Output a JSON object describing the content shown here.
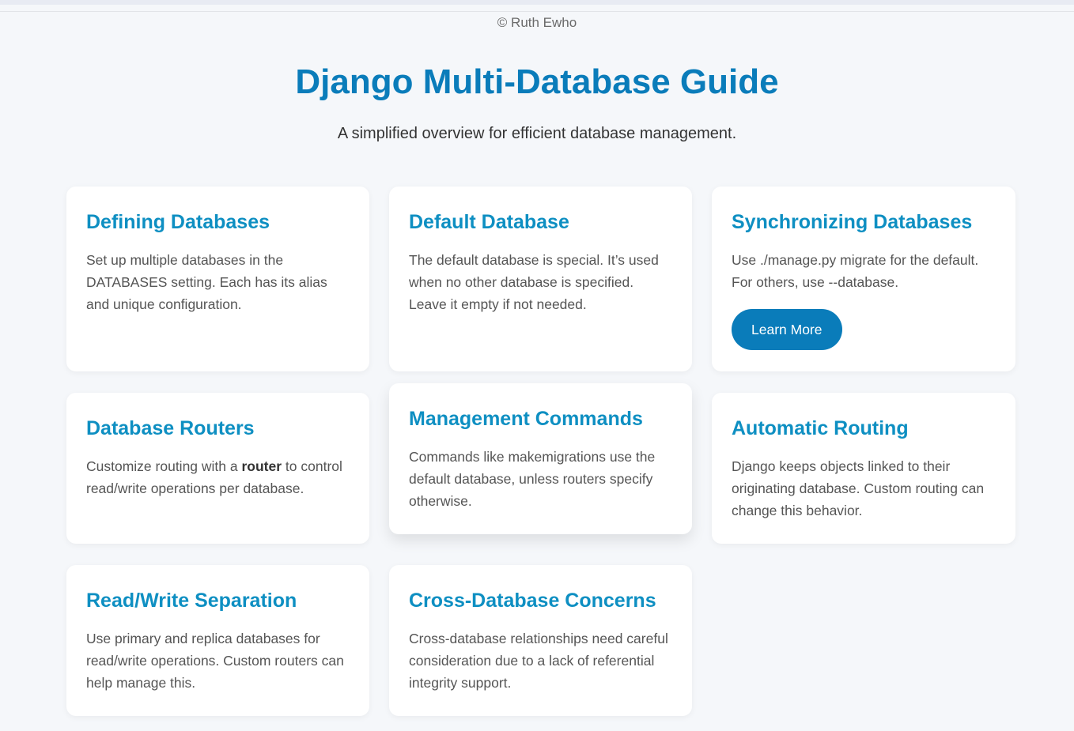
{
  "header": {
    "copyright": "© Ruth Ewho",
    "title": "Django Multi-Database Guide",
    "subtitle": "A simplified overview for efficient database management."
  },
  "cards": [
    {
      "title": "Defining Databases",
      "body": "Set up multiple databases in the DATABASES setting. Each has its alias and unique configuration."
    },
    {
      "title": "Default Database",
      "body": "The default database is special. It’s used when no other database is specified. Leave it empty if not needed."
    },
    {
      "title": "Synchronizing Databases",
      "body": "Use ./manage.py migrate for the default. For others, use --database.",
      "button_label": "Learn More"
    },
    {
      "title": "Database Routers",
      "body_before": "Customize routing with a ",
      "body_strong": "router",
      "body_after": " to control read/write operations per database."
    },
    {
      "title": "Management Commands",
      "body": "Commands like makemigrations use the default database, unless routers specify otherwise."
    },
    {
      "title": "Automatic Routing",
      "body": "Django keeps objects linked to their originating database. Custom routing can change this behavior."
    },
    {
      "title": "Read/Write Separation",
      "body": "Use primary and replica databases for read/write operations. Custom routers can help manage this."
    },
    {
      "title": "Cross-Database Concerns",
      "body": "Cross-database relationships need careful consideration due to a lack of referential integrity support."
    }
  ],
  "colors": {
    "title": "#0a7cba",
    "card_heading": "#0e8fc2",
    "button_bg": "#0a7cba",
    "page_bg": "#f5f7fa"
  }
}
